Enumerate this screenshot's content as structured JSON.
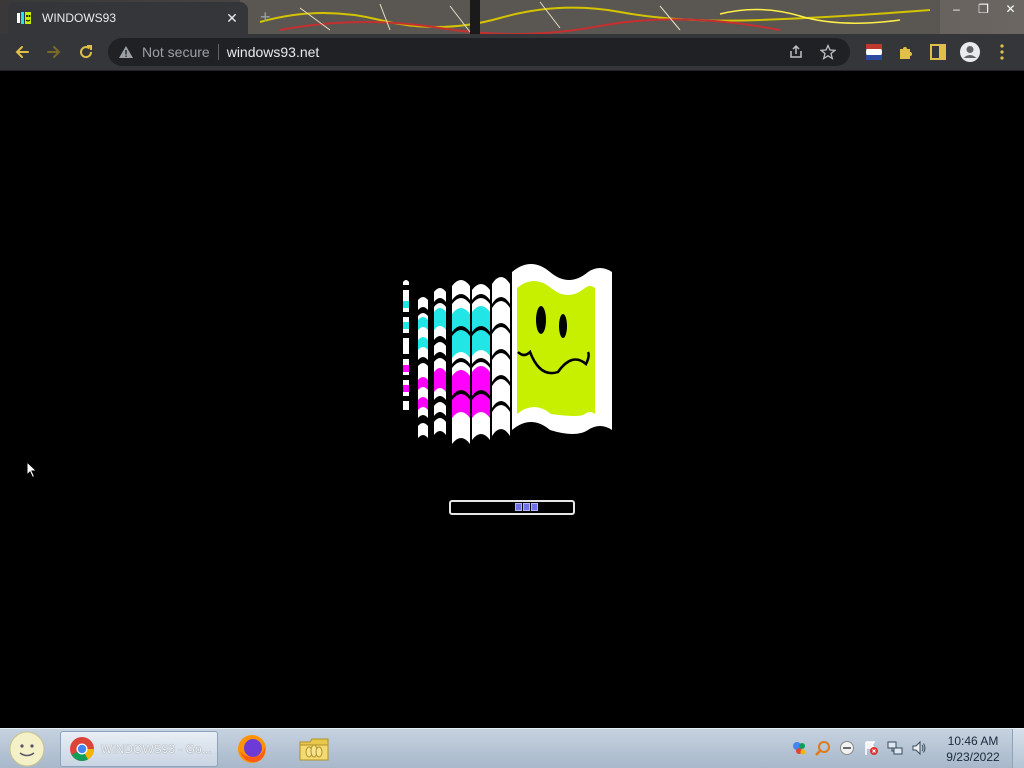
{
  "browser": {
    "tab_title": "WINDOWS93",
    "new_tab_symbol": "+",
    "security_label": "Not secure",
    "url": "windows93.net",
    "window_controls": {
      "minimize": "–",
      "restore": "❐",
      "close": "✕"
    }
  },
  "page": {
    "loading_progress": 0.65
  },
  "taskbar": {
    "chrome_label": "WINDOWS93 - Go...",
    "clock_time": "10:46 AM",
    "clock_date": "9/23/2022"
  },
  "colors": {
    "accent_cyan": "#22e6e6",
    "accent_magenta": "#ff00ff",
    "accent_lime": "#c6f000",
    "loader_blue": "#6f72e6"
  },
  "icons": {
    "favicon": "windows93-favicon",
    "back": "arrow-left-icon",
    "forward": "arrow-right-icon",
    "reload": "reload-icon",
    "warning": "warning-icon",
    "share": "share-icon",
    "bookmark": "star-icon",
    "extension": "puzzle-icon",
    "profile": "profile-icon",
    "menu": "kebab-menu-icon"
  }
}
